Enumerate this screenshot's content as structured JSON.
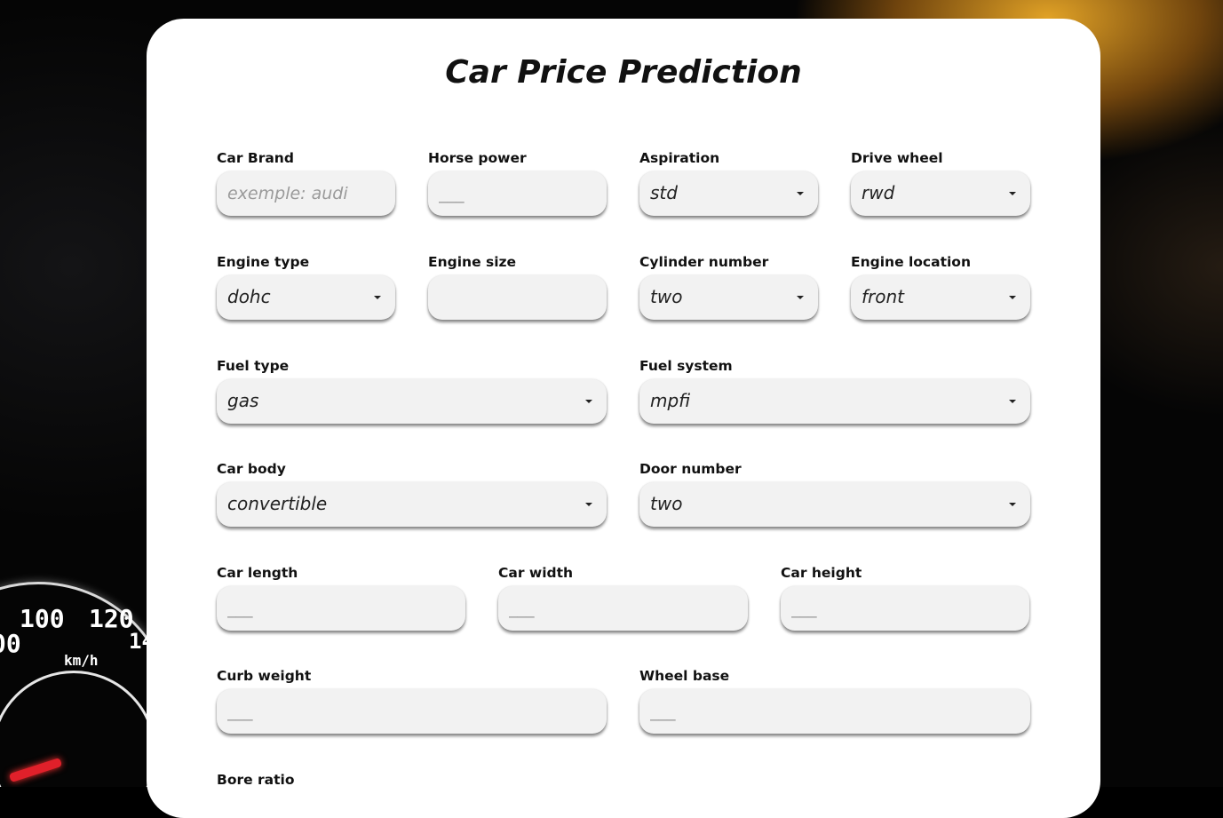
{
  "title": "Car Price Prediction",
  "background": {
    "gauge_labels": [
      "100",
      "120",
      "00",
      "14",
      "km/h"
    ]
  },
  "fields": {
    "car_brand": {
      "label": "Car Brand",
      "placeholder": "exemple: audi"
    },
    "horse_power": {
      "label": "Horse power",
      "placeholder": "___"
    },
    "aspiration": {
      "label": "Aspiration",
      "value": "std"
    },
    "drive_wheel": {
      "label": "Drive wheel",
      "value": "rwd"
    },
    "engine_type": {
      "label": "Engine type",
      "value": "dohc"
    },
    "engine_size": {
      "label": "Engine size"
    },
    "cylinder_number": {
      "label": "Cylinder number",
      "value": "two"
    },
    "engine_location": {
      "label": "Engine location",
      "value": "front"
    },
    "fuel_type": {
      "label": "Fuel type",
      "value": "gas"
    },
    "fuel_system": {
      "label": "Fuel system",
      "value": "mpfi"
    },
    "car_body": {
      "label": "Car body",
      "value": "convertible"
    },
    "door_number": {
      "label": "Door number",
      "value": "two"
    },
    "car_length": {
      "label": "Car length",
      "placeholder": "___"
    },
    "car_width": {
      "label": "Car width",
      "placeholder": "___"
    },
    "car_height": {
      "label": "Car height",
      "placeholder": "___"
    },
    "curb_weight": {
      "label": "Curb weight",
      "placeholder": "___"
    },
    "wheel_base": {
      "label": "Wheel base",
      "placeholder": "___"
    },
    "bore_ratio": {
      "label": "Bore ratio"
    }
  }
}
